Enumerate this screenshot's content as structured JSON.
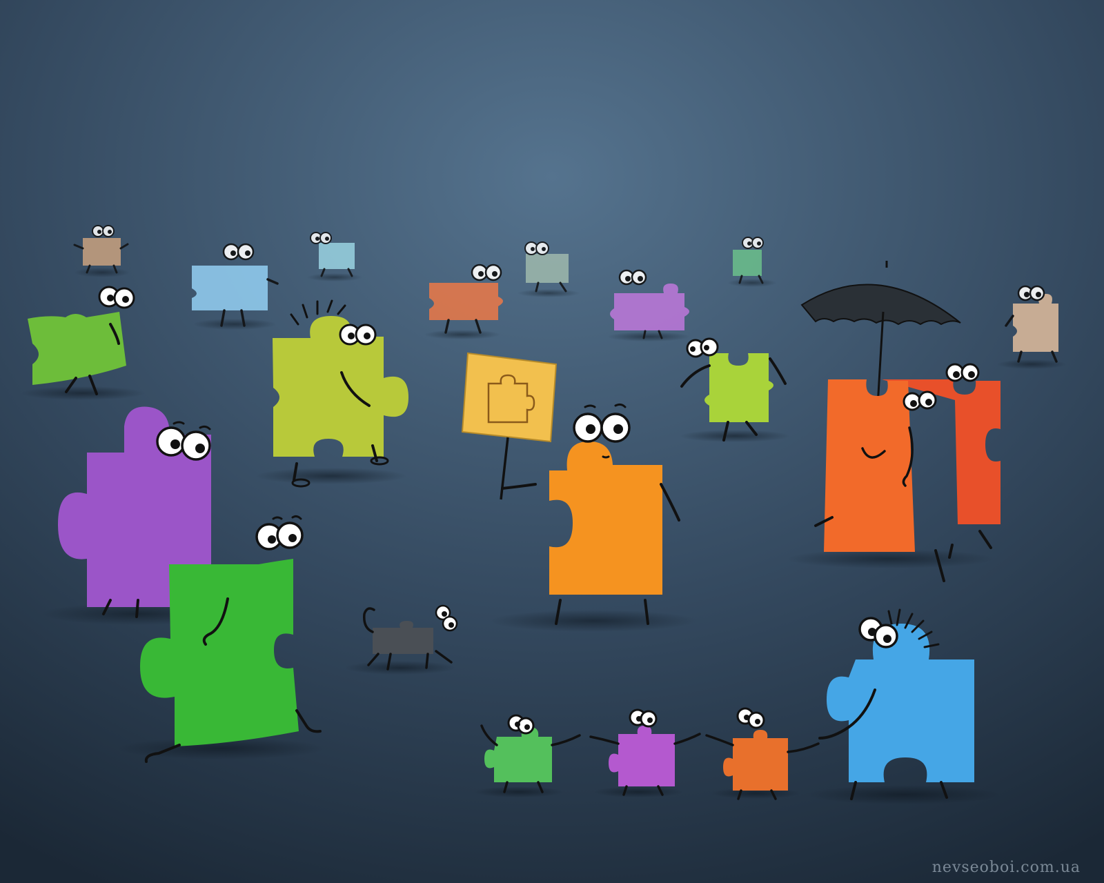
{
  "scene": {
    "subject": "cartoon puzzle-piece characters walking on a blue-grey floor",
    "colors": {
      "background_top": "#4d6b86",
      "background_bottom": "#1c2a38",
      "purple": "#9b55c8",
      "green": "#3cb83c",
      "orange": "#f59320",
      "red_orange": "#e8542a",
      "sky_blue": "#45a6e6",
      "yellow_green": "#b3c83a",
      "lime": "#9fd43a",
      "sign_yellow": "#f2c04e"
    }
  },
  "watermark": {
    "text": "nevseoboi.com.ua"
  }
}
